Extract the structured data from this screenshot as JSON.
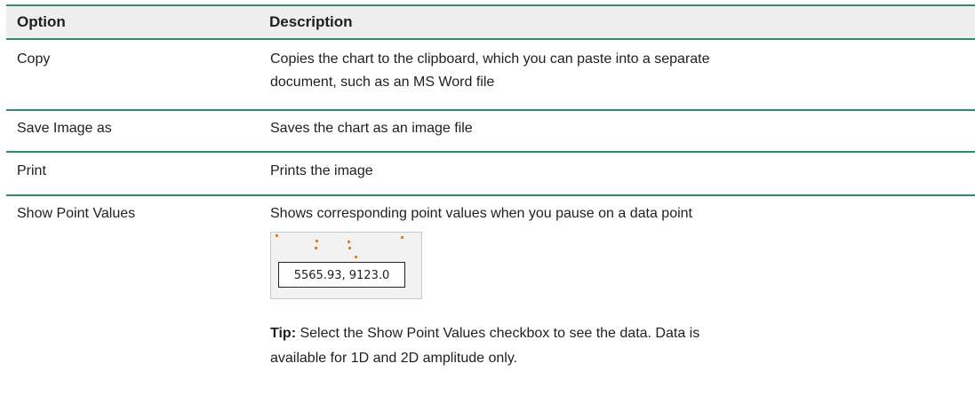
{
  "table": {
    "headers": {
      "option": "Option",
      "description": "Description"
    },
    "rows": [
      {
        "option": "Copy",
        "description_line1": "Copies the chart to the clipboard, which you can paste into a separate",
        "description_line2": "document, such as an MS Word file"
      },
      {
        "option": "Save Image as",
        "description": "Saves the chart as an image file"
      },
      {
        "option": "Print",
        "description": "Prints the image"
      },
      {
        "option": "Show Point Values",
        "description": "Shows corresponding point values when you pause on a data point",
        "point_value_tooltip": "5565.93, 9123.0",
        "tip_label": "Tip:",
        "tip_text_line1": " Select the Show Point Values checkbox to see the data. Data is",
        "tip_text_line2": "available for 1D and 2D amplitude only."
      }
    ]
  },
  "colors": {
    "rule": "#2e8f63",
    "header_bg": "#eeeeee",
    "point_color": "#f07d1a"
  }
}
